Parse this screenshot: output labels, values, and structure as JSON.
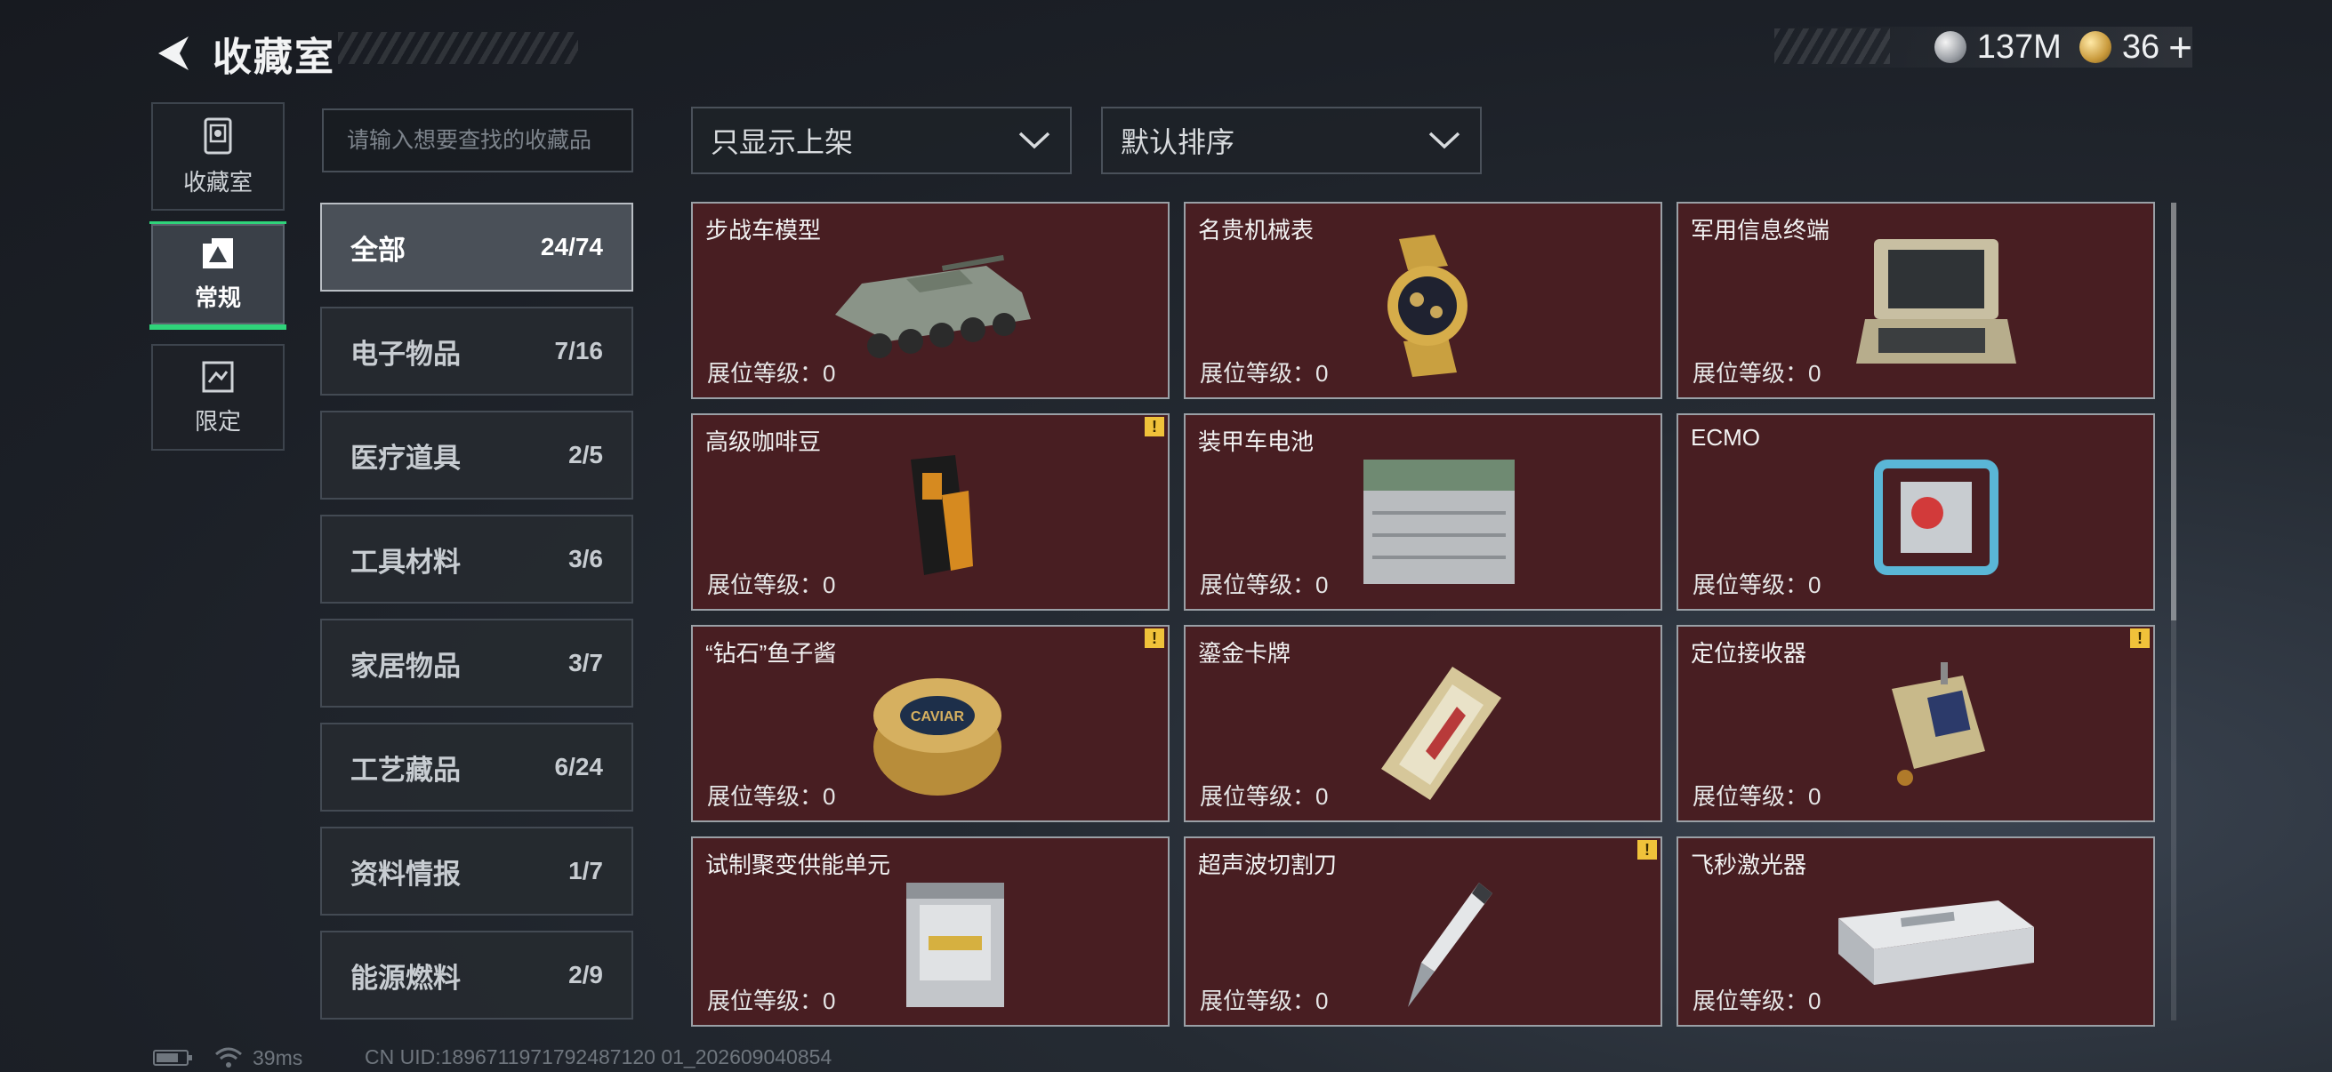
{
  "header": {
    "title": "收藏室",
    "currencies": [
      {
        "icon": "silver-coin-icon",
        "value": "137M"
      },
      {
        "icon": "gold-coin-icon",
        "value": "36"
      }
    ],
    "plus_label": "+"
  },
  "nav": [
    {
      "label": "收藏室",
      "icon": "collection-icon"
    },
    {
      "label": "常规",
      "icon": "regular-icon",
      "active": true
    },
    {
      "label": "限定",
      "icon": "limited-icon"
    }
  ],
  "search": {
    "placeholder": "请输入想要查找的收藏品"
  },
  "categories": [
    {
      "name": "全部",
      "count": "24/74",
      "active": true
    },
    {
      "name": "电子物品",
      "count": "7/16"
    },
    {
      "name": "医疗道具",
      "count": "2/5"
    },
    {
      "name": "工具材料",
      "count": "3/6"
    },
    {
      "name": "家居物品",
      "count": "3/7"
    },
    {
      "name": "工艺藏品",
      "count": "6/24"
    },
    {
      "name": "资料情报",
      "count": "1/7"
    },
    {
      "name": "能源燃料",
      "count": "2/9"
    }
  ],
  "filters": {
    "show": "只显示上架",
    "sort": "默认排序"
  },
  "level_label": "展位等级：0",
  "badge_label": "!",
  "items": [
    {
      "name": "步战车模型",
      "icon": "ifv-model-icon",
      "badge": false
    },
    {
      "name": "名贵机械表",
      "icon": "luxury-watch-icon",
      "badge": false
    },
    {
      "name": "军用信息终端",
      "icon": "military-terminal-icon",
      "badge": false
    },
    {
      "name": "高级咖啡豆",
      "icon": "coffee-beans-icon",
      "badge": true
    },
    {
      "name": "装甲车电池",
      "icon": "armored-battery-icon",
      "badge": false
    },
    {
      "name": "ECMO",
      "icon": "ecmo-icon",
      "badge": false
    },
    {
      "name": "“钻石”鱼子酱",
      "icon": "caviar-tin-icon",
      "badge": true
    },
    {
      "name": "鎏金卡牌",
      "icon": "gilded-card-icon",
      "badge": false
    },
    {
      "name": "定位接收器",
      "icon": "locator-receiver-icon",
      "badge": true
    },
    {
      "name": "试制聚变供能单元",
      "icon": "fusion-unit-icon",
      "badge": false
    },
    {
      "name": "超声波切割刀",
      "icon": "ultrasonic-cutter-icon",
      "badge": true
    },
    {
      "name": "飞秒激光器",
      "icon": "femtosecond-laser-icon",
      "badge": false
    }
  ],
  "item_image_labels": {
    "caviar": "CAVIAR"
  },
  "footer": {
    "ping": "39ms",
    "uid": "CN UID:1896711971792487120 01_202609040854"
  }
}
